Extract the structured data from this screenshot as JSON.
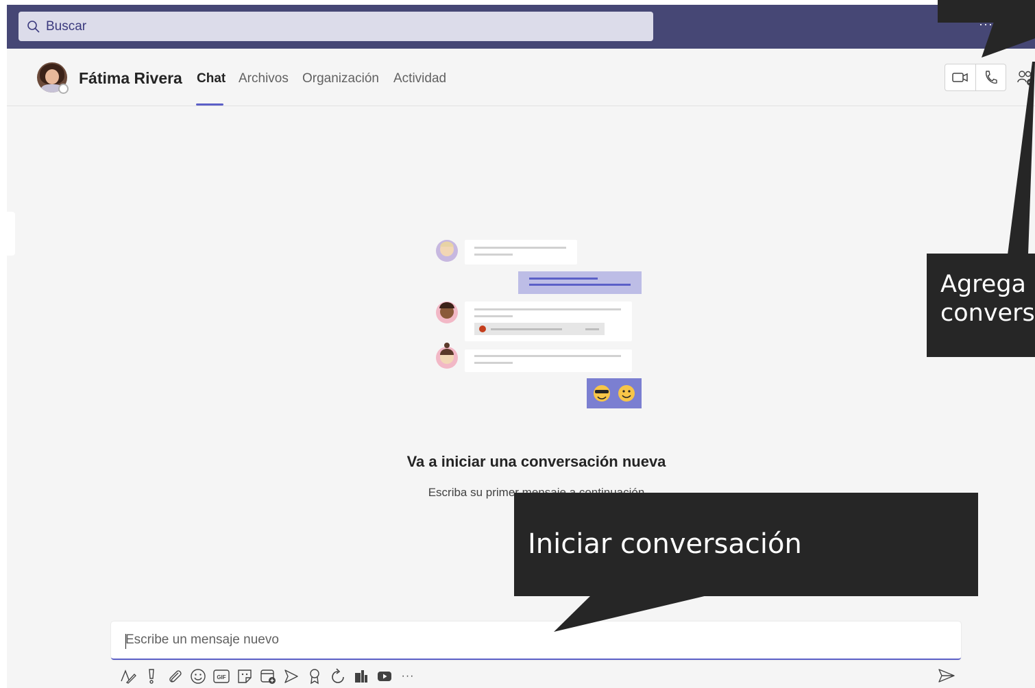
{
  "search": {
    "placeholder": "Buscar"
  },
  "topbar": {
    "more_label": "···"
  },
  "contact": {
    "name": "Fátima Rivera"
  },
  "tabs": [
    {
      "label": "Chat",
      "active": true
    },
    {
      "label": "Archivos",
      "active": false
    },
    {
      "label": "Organización",
      "active": false
    },
    {
      "label": "Actividad",
      "active": false
    }
  ],
  "empty_state": {
    "title": "Va a iniciar una conversación nueva",
    "subtitle": "Escriba su primer mensaje a continuación"
  },
  "composer": {
    "placeholder": "Escribe un mensaje nuevo"
  },
  "toolbar": {
    "icons": [
      "format-icon",
      "priority-icon",
      "attach-icon",
      "emoji-icon",
      "gif-icon",
      "sticker-icon",
      "schedule-meeting-icon",
      "stream-icon",
      "praise-icon",
      "loop-icon",
      "app-icon",
      "youtube-icon",
      "more-options-icon"
    ],
    "gif_label": "GIF",
    "more_label": "···"
  },
  "callouts": {
    "right_line1": "Agrega",
    "right_line2": "convers",
    "bottom": "Iniciar conversación"
  },
  "colors": {
    "topbar": "#464775",
    "accent": "#5b5fc7",
    "callout": "#262626",
    "background": "#f5f5f5"
  }
}
